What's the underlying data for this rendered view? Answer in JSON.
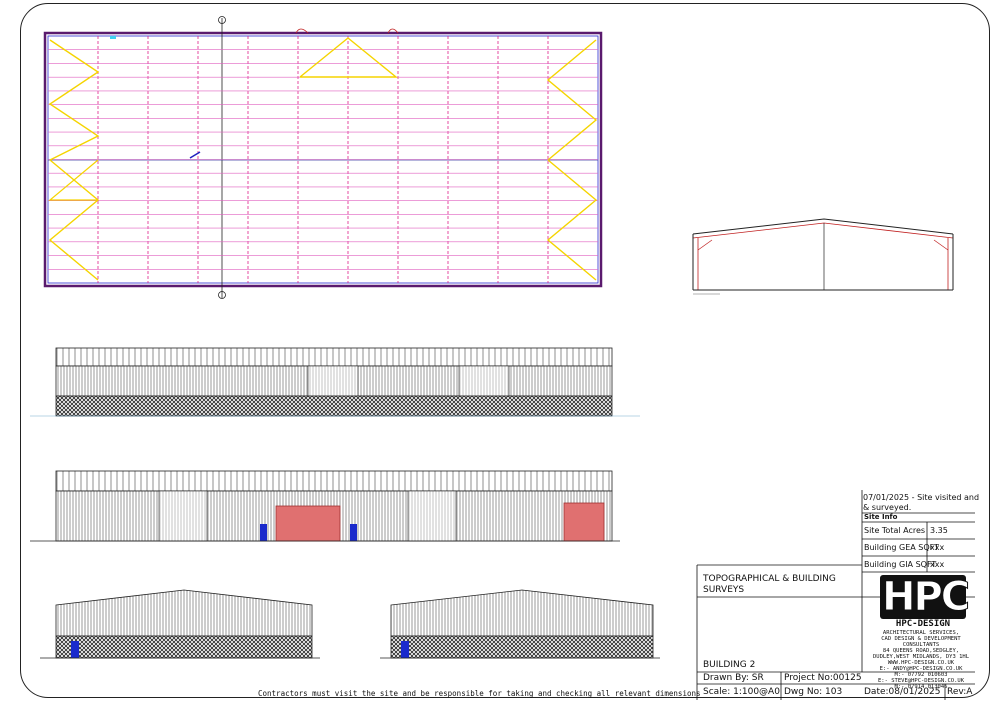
{
  "drawing": {
    "plan_caption": "",
    "notes": {
      "site_visit": "07/01/2025 - Site visited and & surveyed."
    },
    "site_info": {
      "header": "Site Info",
      "rows": [
        {
          "label": "Site Total Acres",
          "value": "3.35"
        },
        {
          "label": "Building GEA SQFT",
          "value": "xxx"
        },
        {
          "label": "Building GIA SQFT",
          "value": "xxx"
        }
      ]
    },
    "title_block": {
      "project_title_line1": "TOPOGRAPHICAL & BUILDING",
      "project_title_line2": "SURVEYS",
      "building": "BUILDING 2",
      "drawn_by": "Drawn By:  SR",
      "project_no": "Project No:00125",
      "scale": "Scale:  1:100@A0",
      "dwg_no": "Dwg No:  103",
      "date": "Date:08/01/2025",
      "rev": "Rev:A"
    },
    "company": {
      "logo_text": "HPC",
      "name": "HPC-DESIGN",
      "services": "ARCHITECTURAL SERVICES,",
      "services2": "CAD DESIGN & DEVELOPMENT",
      "consultants": "CONSULTANTS",
      "address1": "84 QUEENS ROAD,SEDGLEY,",
      "address2": "DUDLEY,WEST MIDLANDS, DY3 1HL",
      "web": "WWW.HPC-DESIGN.CO.UK",
      "email1": "E:- ANDY@HPC-DESIGN.CO.UK",
      "mobile1": "M:- 07792 010603",
      "email2": "E:- STEVE@HPC-DESIGN.CO.UK",
      "mobile2": "M:- 07914 013046"
    },
    "footer_note": "Contractors must visit the site and be responsible for taking and checking all relevant dimensions"
  }
}
